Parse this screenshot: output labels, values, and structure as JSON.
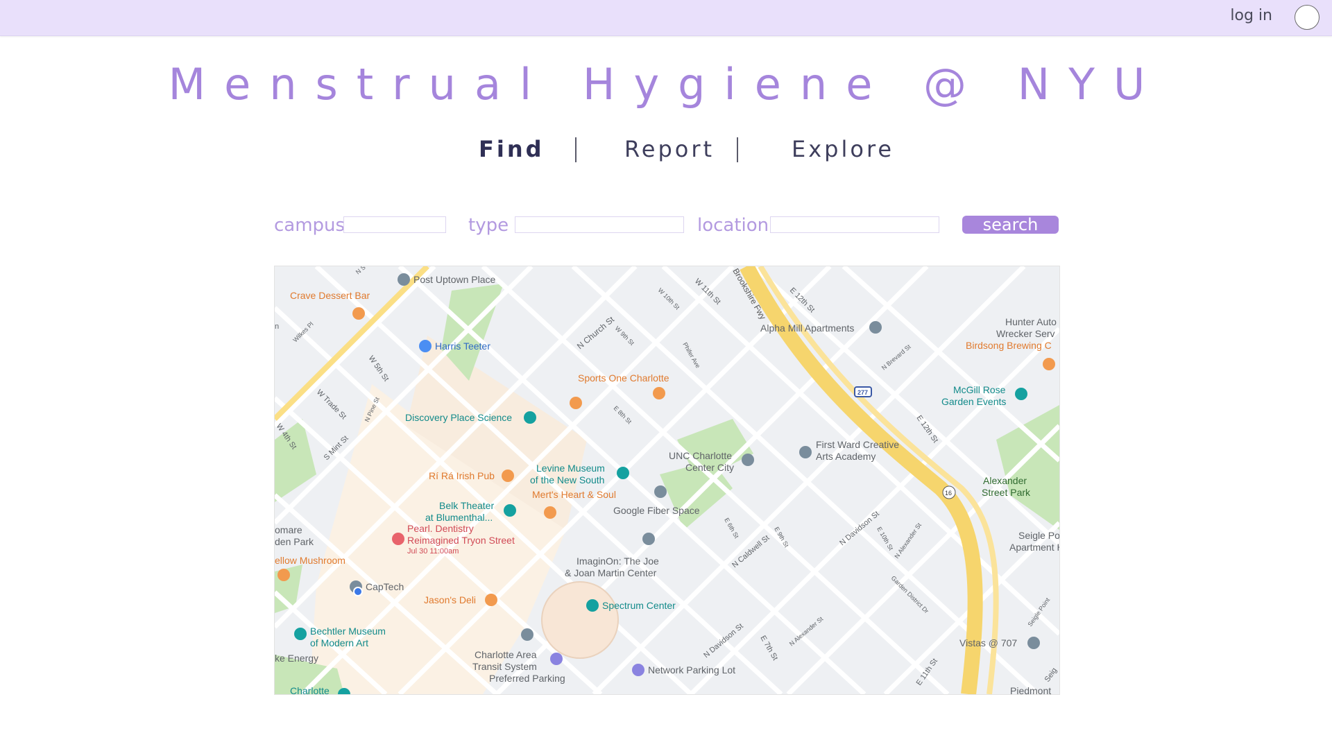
{
  "header": {
    "login_label": "log in"
  },
  "title": "Menstrual Hygiene @ NYU",
  "nav": {
    "find": "Find",
    "report": "Report",
    "explore": "Explore"
  },
  "filters": {
    "campus_label": "campus",
    "type_label": "type",
    "location_label": "location",
    "search_label": "search"
  },
  "map": {
    "pois": {
      "post_uptown": "Post Uptown Place",
      "crave": "Crave Dessert Bar",
      "harris": "Harris Teeter",
      "sports_one": "Sports One Charlotte",
      "discovery": "Discovery Place Science",
      "alpha_mill": "Alpha Mill Apartments",
      "hunter_1": "Hunter Auto",
      "hunter_2": "Wrecker Serv",
      "birdsong": "Birdsong Brewing C",
      "mcgill_1": "McGill Rose",
      "mcgill_2": "Garden Events",
      "unc_1": "UNC Charlotte",
      "unc_2": "Center City",
      "first_ward_1": "First Ward Creative",
      "first_ward_2": "Arts Academy",
      "levine_1": "Levine Museum",
      "levine_2": "of the New South",
      "ri_ra": "Rí Rá Irish Pub",
      "merts": "Mert's Heart & Soul",
      "belk_1": "Belk Theater",
      "belk_2": "at Blumenthal...",
      "google_fiber": "Google Fiber Space",
      "pearl_1": "Pearl. Dentistry",
      "pearl_2": "Reimagined Tryon Street",
      "pearl_3": "Jul 30 11:00am",
      "romare_1": "omare",
      "romare_2": "den Park",
      "yellow_mush": "ellow Mushroom",
      "captech": "CapTech",
      "imaginon_1": "ImaginOn: The Joe",
      "imaginon_2": "& Joan Martin Center",
      "jasons": "Jason's Deli",
      "spectrum": "Spectrum Center",
      "bechtler_1": "Bechtler Museum",
      "bechtler_2": "of Modern Art",
      "duke": "ke Energy",
      "charlotte": "Charlotte",
      "transit_1": "Charlotte Area",
      "transit_2": "Transit System",
      "transit_3": "Preferred Parking",
      "network_parking": "Network Parking Lot",
      "vistas": "Vistas @ 707",
      "alexander_1": "Alexander",
      "alexander_2": "Street Park",
      "seigle_1": "Seigle Po",
      "seigle_2": "Apartment Hon",
      "piedmont": "Piedmont"
    },
    "streets": {
      "s1": "W 11th St",
      "s2": "Brookshire Fwy",
      "s3": "E 12th St",
      "s4": "W 10th St",
      "s5": "N Church St",
      "s6": "W 9th St",
      "s7": "Phifer Ave",
      "s8": "N Brevard St",
      "s9": "W 5th St",
      "s10": "W Trade St",
      "s11": "N Pine St",
      "s12": "W 4th St",
      "s13": "S Mint St",
      "s14": "E 8th St",
      "s15": "E 12th St",
      "s16": "N Caldwell St",
      "s17": "E 9th St",
      "s18": "N Davidson St",
      "s19": "E 10th St",
      "s20": "N Alexander St",
      "s21": "Garden District Dr",
      "s22": "E 6th St",
      "s23": "N Davidson St",
      "s24": "E 7th St",
      "s25": "N Alexander St",
      "s26": "Seigle Point",
      "s27": "Wilkes Pl",
      "s28": "E 11th St",
      "s29": "N S",
      "s30": "n",
      "s31": "Seig"
    },
    "shields": {
      "i277": "277",
      "r16": "16"
    }
  }
}
